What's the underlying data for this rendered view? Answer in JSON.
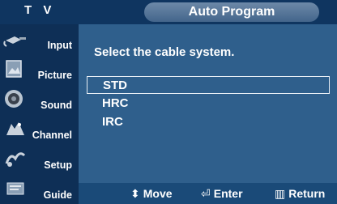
{
  "header": {
    "source_label": "T V",
    "menu_title": "Auto Program"
  },
  "sidebar": {
    "items": [
      {
        "label": "Input",
        "icon": "input-plug-icon"
      },
      {
        "label": "Picture",
        "icon": "picture-icon"
      },
      {
        "label": "Sound",
        "icon": "sound-speaker-icon"
      },
      {
        "label": "Channel",
        "icon": "channel-icon"
      },
      {
        "label": "Setup",
        "icon": "setup-icon"
      },
      {
        "label": "Guide",
        "icon": "guide-icon"
      }
    ]
  },
  "main": {
    "prompt": "Select the cable system.",
    "options": [
      {
        "label": "STD",
        "selected": true
      },
      {
        "label": "HRC",
        "selected": false
      },
      {
        "label": "IRC",
        "selected": false
      }
    ]
  },
  "footer": {
    "move_label": "Move",
    "enter_label": "Enter",
    "return_label": "Return"
  },
  "colors": {
    "background": "#2f5f8c",
    "sidebar": "#0e2f56",
    "title_bar": "#0f3560"
  }
}
